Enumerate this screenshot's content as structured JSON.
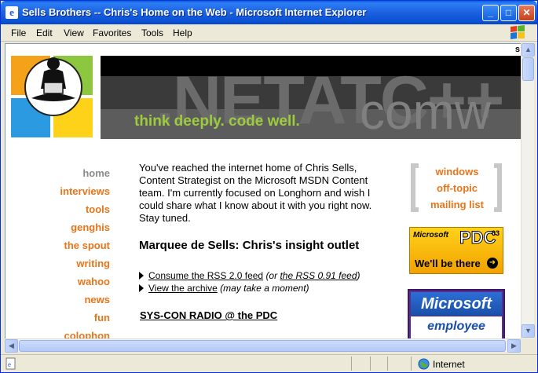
{
  "window": {
    "title": "Sells Brothers -- Chris's Home on the Web - Microsoft Internet Explorer"
  },
  "menu": [
    "File",
    "Edit",
    "View",
    "Favorites",
    "Tools",
    "Help"
  ],
  "banner": {
    "tagline": "think deeply. code well.",
    "big_text": ".NETATC++",
    "big_text_2": "comw"
  },
  "corner_letter": "s",
  "nav": [
    "home",
    "interviews",
    "tools",
    "genghis",
    "the spout",
    "writing",
    "wahoo",
    "news",
    "fun",
    "colophon"
  ],
  "main": {
    "intro": "You've reached the internet home of Chris Sells, Content Strategist on the Microsoft MSDN Content team. I'm currently focused on Longhorn and wish I could share what I know about it with you right now. Stay tuned.",
    "heading": "Marquee de Sells: Chris's insight outlet",
    "rss_link": "Consume the RSS 2.0 feed",
    "rss_or": "(or",
    "rss_091": "the RSS 0.91 feed",
    "rss_close": ")",
    "archive_link": "View the archive",
    "archive_note": "(may take a moment)",
    "syscon": "SYS-CON RADIO @ the PDC"
  },
  "right_links": [
    "windows",
    "off-topic",
    "mailing list"
  ],
  "pdc_badge": {
    "ms": "Microsoft",
    "pdc": "PDC",
    "year": "03",
    "text": "We'll be there"
  },
  "ms_badge": {
    "top": "Microsoft",
    "bottom": "employee"
  },
  "status": {
    "zone": "Internet"
  },
  "colors": {
    "accent": "#e8751a",
    "nav_home": "#8c8c8c",
    "tagline": "#9ccc3c",
    "titlebar": "#0a5fe0"
  }
}
